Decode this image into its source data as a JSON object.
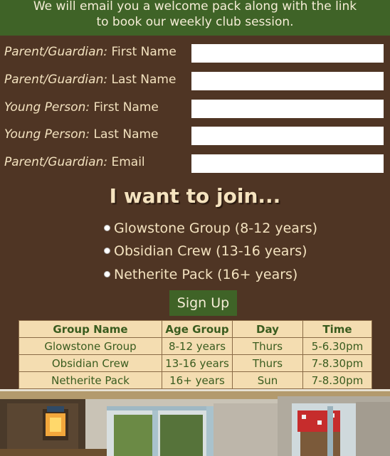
{
  "banner": {
    "line1": "We will email you a welcome pack along with the link",
    "line2": "to book our weekly club session."
  },
  "form": {
    "fields": [
      {
        "role": "Parent/Guardian:",
        "name": "First Name"
      },
      {
        "role": "Parent/Guardian:",
        "name": "Last Name"
      },
      {
        "role": "Young Person:",
        "name": "First Name"
      },
      {
        "role": "Young Person:",
        "name": "Last Name"
      },
      {
        "role": "Parent/Guardian:",
        "name": "Email"
      }
    ]
  },
  "join": {
    "title": "I want to join...",
    "options": [
      "Glowstone Group (8-12 years)",
      "Obsidian Crew (13-16 years)",
      "Netherite Pack (16+ years)"
    ],
    "button": "Sign Up"
  },
  "table": {
    "headers": [
      "Group Name",
      "Age Group",
      "Day",
      "Time"
    ],
    "rows": [
      [
        "Glowstone Group",
        "8-12 years",
        "Thurs",
        "5-6.30pm"
      ],
      [
        "Obsidian Crew",
        "13-16 years",
        "Thurs",
        "7-8.30pm"
      ],
      [
        "Netherite Pack",
        "16+ years",
        "Sun",
        "7-8.30pm"
      ]
    ]
  },
  "colors": {
    "background": "#4f3524",
    "banner": "#3f6327",
    "button": "#3f6327",
    "table": "#f4ddb1"
  }
}
